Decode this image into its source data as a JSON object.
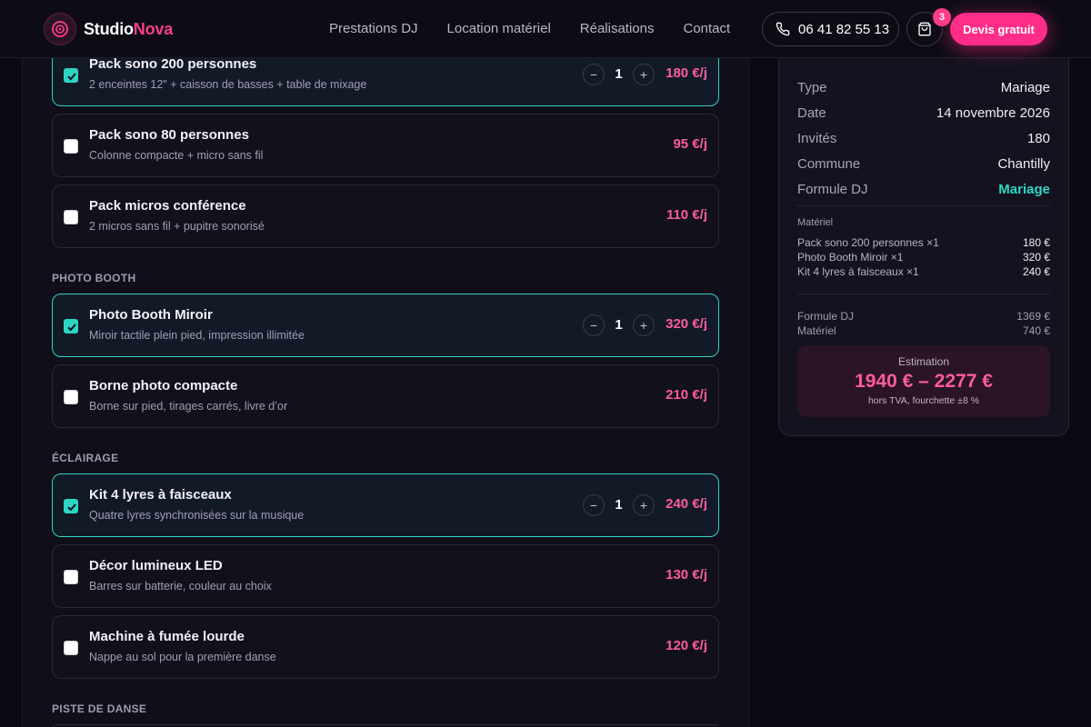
{
  "brand": {
    "name_main": "Studio",
    "name_accent": "Nova"
  },
  "nav": {
    "items": [
      "Prestations DJ",
      "Location matériel",
      "Réalisations",
      "Contact"
    ]
  },
  "header": {
    "phone": "06 41 82 55 13",
    "cart_count": "3",
    "cta_label": "Devis gratuit"
  },
  "sections": {
    "photo_booth": "PHOTO BOOTH",
    "eclairage": "ÉCLAIRAGE",
    "piste": "PISTE DE DANSE"
  },
  "items": [
    {
      "name": "Pack sono 200 personnes",
      "desc": "2 enceintes 12\" + caisson de basses + table de mixage",
      "price": "180 €/j",
      "qty": "1",
      "selected": true
    },
    {
      "name": "Pack sono 80 personnes",
      "desc": "Colonne compacte + micro sans fil",
      "price": "95 €/j",
      "selected": false
    },
    {
      "name": "Pack micros conférence",
      "desc": "2 micros sans fil + pupitre sonorisé",
      "price": "110 €/j",
      "selected": false
    },
    {
      "name": "Photo Booth Miroir",
      "desc": "Miroir tactile plein pied, impression illimitée",
      "price": "320 €/j",
      "qty": "1",
      "selected": true
    },
    {
      "name": "Borne photo compacte",
      "desc": "Borne sur pied, tirages carrés, livre d’or",
      "price": "210 €/j",
      "selected": false
    },
    {
      "name": "Kit 4 lyres à faisceaux",
      "desc": "Quatre lyres synchronisées sur la musique",
      "price": "240 €/j",
      "qty": "1",
      "selected": true
    },
    {
      "name": "Décor lumineux LED",
      "desc": "Barres sur batterie, couleur au choix",
      "price": "130 €/j",
      "selected": false
    },
    {
      "name": "Machine à fumée lourde",
      "desc": "Nappe au sol pour la première danse",
      "price": "120 €/j",
      "selected": false
    }
  ],
  "summary": {
    "details": [
      {
        "key": "Type",
        "value": "Mariage"
      },
      {
        "key": "Date",
        "value": "14 novembre 2026"
      },
      {
        "key": "Invités",
        "value": "180"
      },
      {
        "key": "Commune",
        "value": "Chantilly"
      },
      {
        "key": "Formule DJ",
        "value": "Mariage"
      }
    ],
    "materiel_label": "Matériel",
    "materiel": [
      {
        "name": "Pack sono 200 personnes ×1",
        "price": "180 €"
      },
      {
        "name": "Photo Booth Miroir ×1",
        "price": "320 €"
      },
      {
        "name": "Kit 4 lyres à faisceaux ×1",
        "price": "240 €"
      }
    ],
    "totals": [
      {
        "key": "Formule DJ",
        "value": "1369 €"
      },
      {
        "key": "Matériel",
        "value": "740 €"
      }
    ],
    "estimate_label": "Estimation",
    "estimate_range": "1940 € – 2277 €",
    "estimate_note": "hors TVA, fourchette ±8 %"
  },
  "colors": {
    "accent_pink": "#ff2d87",
    "accent_teal": "#2ed5c4",
    "background": "#0b0a13"
  }
}
